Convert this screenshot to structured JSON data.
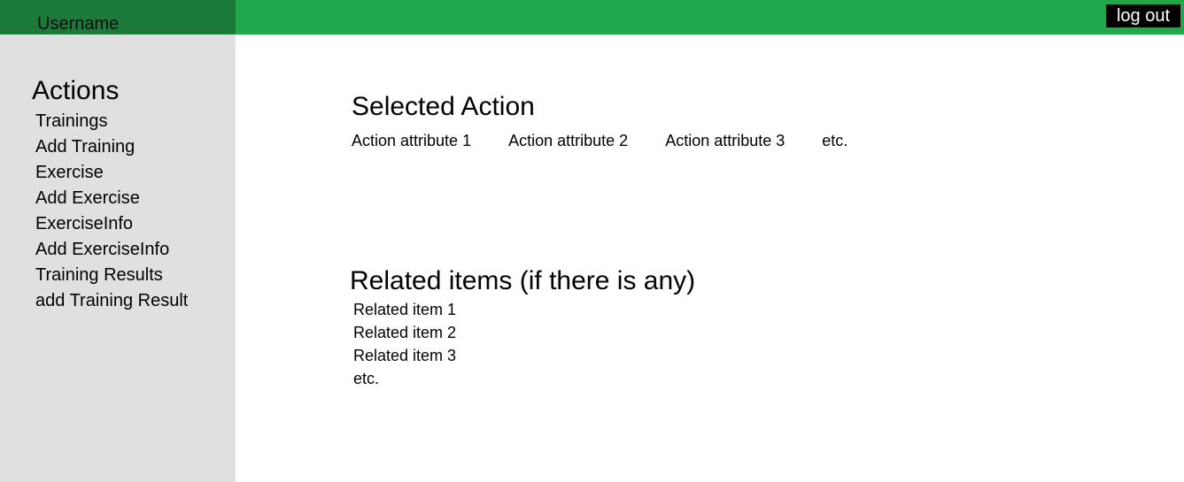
{
  "header": {
    "username": "Username",
    "logout_label": "log out"
  },
  "sidebar": {
    "title": "Actions",
    "items": [
      "Trainings",
      "Add Training",
      "Exercise",
      "Add Exercise",
      "ExerciseInfo",
      "Add ExerciseInfo",
      "Training Results",
      "add Training Result"
    ]
  },
  "main": {
    "selected_title": "Selected Action",
    "attributes": [
      "Action attribute 1",
      "Action attribute 2",
      "Action attribute 3",
      "etc."
    ],
    "related_title": "Related items (if there is any)",
    "related_items": [
      "Related item 1",
      "Related item 2",
      "Related item 3",
      "etc."
    ]
  },
  "colors": {
    "topbar": "#20a84a",
    "user_block": "#1b7a3a",
    "sidebar": "#e0e0e0",
    "logout_bg": "#000000"
  }
}
